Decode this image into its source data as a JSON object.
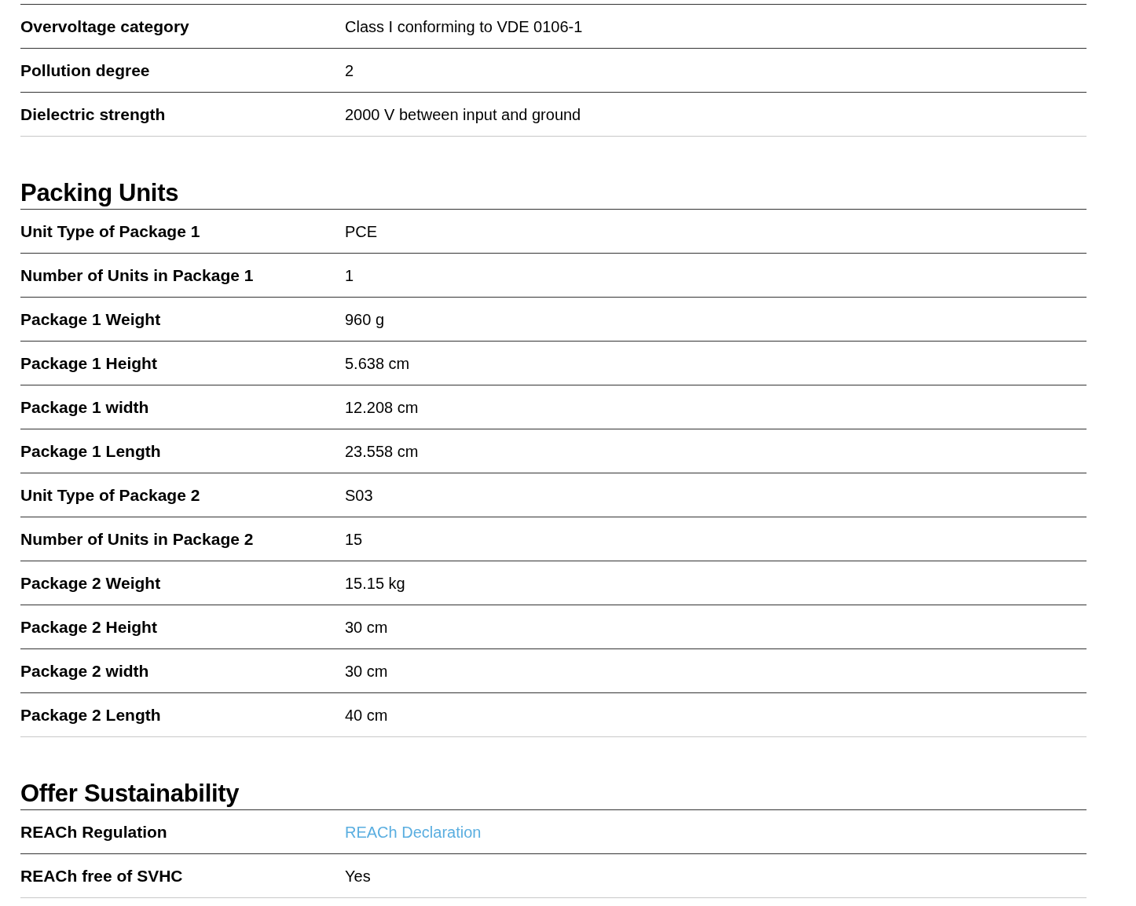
{
  "sections": [
    {
      "rows": [
        {
          "label": "Overvoltage category",
          "value": "Class I conforming to VDE 0106-1",
          "kind": "text"
        },
        {
          "label": "Pollution degree",
          "value": "2",
          "kind": "text"
        },
        {
          "label": "Dielectric strength",
          "value": "2000 V between input and ground",
          "kind": "text"
        }
      ]
    },
    {
      "title": "Packing Units",
      "rows": [
        {
          "label": "Unit Type of Package 1",
          "value": "PCE",
          "kind": "text"
        },
        {
          "label": "Number of Units in Package 1",
          "value": "1",
          "kind": "text"
        },
        {
          "label": "Package 1 Weight",
          "value": "960 g",
          "kind": "text"
        },
        {
          "label": "Package 1 Height",
          "value": "5.638 cm",
          "kind": "text"
        },
        {
          "label": "Package 1 width",
          "value": "12.208 cm",
          "kind": "text"
        },
        {
          "label": "Package 1 Length",
          "value": "23.558 cm",
          "kind": "text"
        },
        {
          "label": "Unit Type of Package 2",
          "value": "S03",
          "kind": "text"
        },
        {
          "label": "Number of Units in Package 2",
          "value": "15",
          "kind": "text"
        },
        {
          "label": "Package 2 Weight",
          "value": "15.15 kg",
          "kind": "text"
        },
        {
          "label": "Package 2 Height",
          "value": "30 cm",
          "kind": "text"
        },
        {
          "label": "Package 2 width",
          "value": "30 cm",
          "kind": "text"
        },
        {
          "label": "Package 2 Length",
          "value": "40 cm",
          "kind": "text"
        }
      ]
    },
    {
      "title": "Offer Sustainability",
      "rows": [
        {
          "label": "REACh Regulation",
          "value": "REACh Declaration",
          "kind": "link"
        },
        {
          "label": "REACh free of SVHC",
          "value": "Yes",
          "kind": "text"
        }
      ]
    }
  ]
}
